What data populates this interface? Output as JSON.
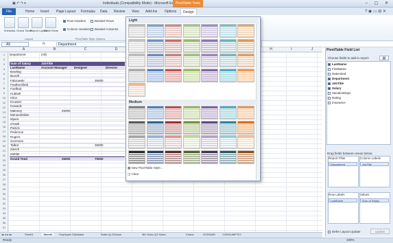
{
  "window": {
    "title": "Individuals (Compatibility Mode) - Microsoft Excel",
    "context_tab": "PivotTable Tools",
    "controls": "– ▢ ✕"
  },
  "quick_access": "▣ ↶ ↷ ▾",
  "tabs": [
    "Home",
    "Insert",
    "Page Layout",
    "Formulas",
    "Data",
    "Review",
    "View",
    "Add-Ins",
    "Options",
    "Design"
  ],
  "file_tab": "File",
  "tab_right": "? ◉ ▭ ⊟ ✕",
  "ribbon": {
    "layout_buttons": [
      "Subtotals",
      "Grand Totals",
      "Report Layout",
      "Blank Rows"
    ],
    "layout_group": "Layout",
    "options": [
      {
        "label": "Row Headers",
        "on": true
      },
      {
        "label": "Banded Rows",
        "on": false
      },
      {
        "label": "Column Headers",
        "on": true
      },
      {
        "label": "Banded Columns",
        "on": false
      }
    ],
    "options_group": "PivotTable Style Options"
  },
  "formula_bar": {
    "name": "A5",
    "fx": "fx",
    "value": "Department"
  },
  "columns": [
    "A",
    "B",
    "C",
    "D",
    "E",
    "F",
    "G",
    "H",
    "I",
    "J"
  ],
  "sheet": {
    "filter": {
      "label": "Department",
      "value": "(All)"
    },
    "header": [
      "Sum of Salary",
      "JobTitle"
    ],
    "subheader": [
      "LastName",
      "Account Manager",
      "Designer",
      "Director"
    ],
    "rows": [
      {
        "name": "Bowling",
        "v1": "",
        "v2": ""
      },
      {
        "name": "Burrell",
        "v1": "",
        "v2": ""
      },
      {
        "name": "Fabrowski",
        "v1": "",
        "v2": "35000"
      },
      {
        "name": "Feathersfield",
        "v1": "",
        "v2": ""
      },
      {
        "name": "Fireffeld",
        "v1": "",
        "v2": ""
      },
      {
        "name": "Hubbell",
        "v1": "",
        "v2": ""
      },
      {
        "name": "Kline",
        "v1": "",
        "v2": ""
      },
      {
        "name": "Knutsen",
        "v1": "",
        "v2": ""
      },
      {
        "name": "Kowacik",
        "v1": "",
        "v2": ""
      },
      {
        "name": "Maloney",
        "v1": "25000",
        "v2": ""
      },
      {
        "name": "Mennenfelder",
        "v1": "",
        "v2": ""
      },
      {
        "name": "Myers",
        "v1": "",
        "v2": ""
      },
      {
        "name": "O'Neill",
        "v1": "",
        "v2": ""
      },
      {
        "name": "Patrick",
        "v1": "",
        "v2": ""
      },
      {
        "name": "Pederson",
        "v1": "",
        "v2": ""
      },
      {
        "name": "Rogers",
        "v1": "",
        "v2": ""
      },
      {
        "name": "Sorensen",
        "v1": "",
        "v2": ""
      },
      {
        "name": "Talbot",
        "v1": "",
        "v2": "35000"
      },
      {
        "name": "Ziesch",
        "v1": "",
        "v2": ""
      },
      {
        "name": "Ziebler",
        "v1": "",
        "v2": ""
      }
    ],
    "grand_total": {
      "label": "Grand Total",
      "v1": "25000",
      "v2": "70000"
    }
  },
  "gallery": {
    "light": "Light",
    "medium": "Medium",
    "new_style": "New PivotTable Style...",
    "clear": "Clear",
    "light_colors": [
      "#b8b8b8",
      "#7e9ec8",
      "#c98a86",
      "#a9c283",
      "#9d8cbc",
      "#7fbcc9",
      "#e3a86c",
      "#c2c2c2",
      "#6f8fc1",
      "#c56c66",
      "#97b56b",
      "#8a74b0",
      "#6bb1c1",
      "#e29850",
      "#bdbdbd",
      "#6a8bbd",
      "#d07f79",
      "#a3c27b",
      "#9c86c0",
      "#74b6c5",
      "#ea9c5a",
      "#aaaaaa",
      "#4f7cbf",
      "#c0504d",
      "#9bbb59",
      "#8064a2",
      "#4bacc6",
      "#f79646",
      "#f2b38e"
    ],
    "medium_colors": [
      "#7f7f7f",
      "#4f81bd",
      "#c0504d",
      "#9bbb59",
      "#8064a2",
      "#4bacc6",
      "#f79646",
      "#595959",
      "#365f91",
      "#943634",
      "#76923c",
      "#5f497a",
      "#31849b",
      "#e36c09",
      "#a5a5a5",
      "#95b3d7",
      "#d99694",
      "#c3d69b",
      "#b2a1c7",
      "#92cddc",
      "#fac090",
      "#262626",
      "#1f3864",
      "#632523",
      "#4f6228",
      "#3f3151",
      "#215868",
      "#974806"
    ]
  },
  "panel": {
    "title": "PivotTable Field List",
    "choose": "Choose fields to add to report:",
    "fields": [
      {
        "n": "LastName",
        "on": true
      },
      {
        "n": "FirstName",
        "on": false
      },
      {
        "n": "DateHired",
        "on": false
      },
      {
        "n": "Department",
        "on": true
      },
      {
        "n": "JobTitle",
        "on": true
      },
      {
        "n": "Salary",
        "on": true
      },
      {
        "n": "VacationDays",
        "on": false
      },
      {
        "n": "Rating",
        "on": false
      },
      {
        "n": "Insurance",
        "on": false
      }
    ],
    "drag": "Drag fields between areas below:",
    "report_filter": "Report Filter",
    "column_labels": "Column Labels",
    "row_labels": "Row Labels",
    "values": "Values",
    "chips": {
      "filter": "Department",
      "column": "JobTitle",
      "row": "LastName",
      "values": "Sum of Salary"
    },
    "defer": "Defer Layout Update",
    "update": "Update"
  },
  "sheet_tabs": [
    "Sheet1",
    "Sheet2",
    "Employee Database",
    "Sales by Division",
    "5th Video Q3 Sales",
    "Charts",
    "SCENARI",
    "CONSUMPTIO"
  ],
  "status": {
    "ready": "Ready",
    "zoom": "100%"
  }
}
